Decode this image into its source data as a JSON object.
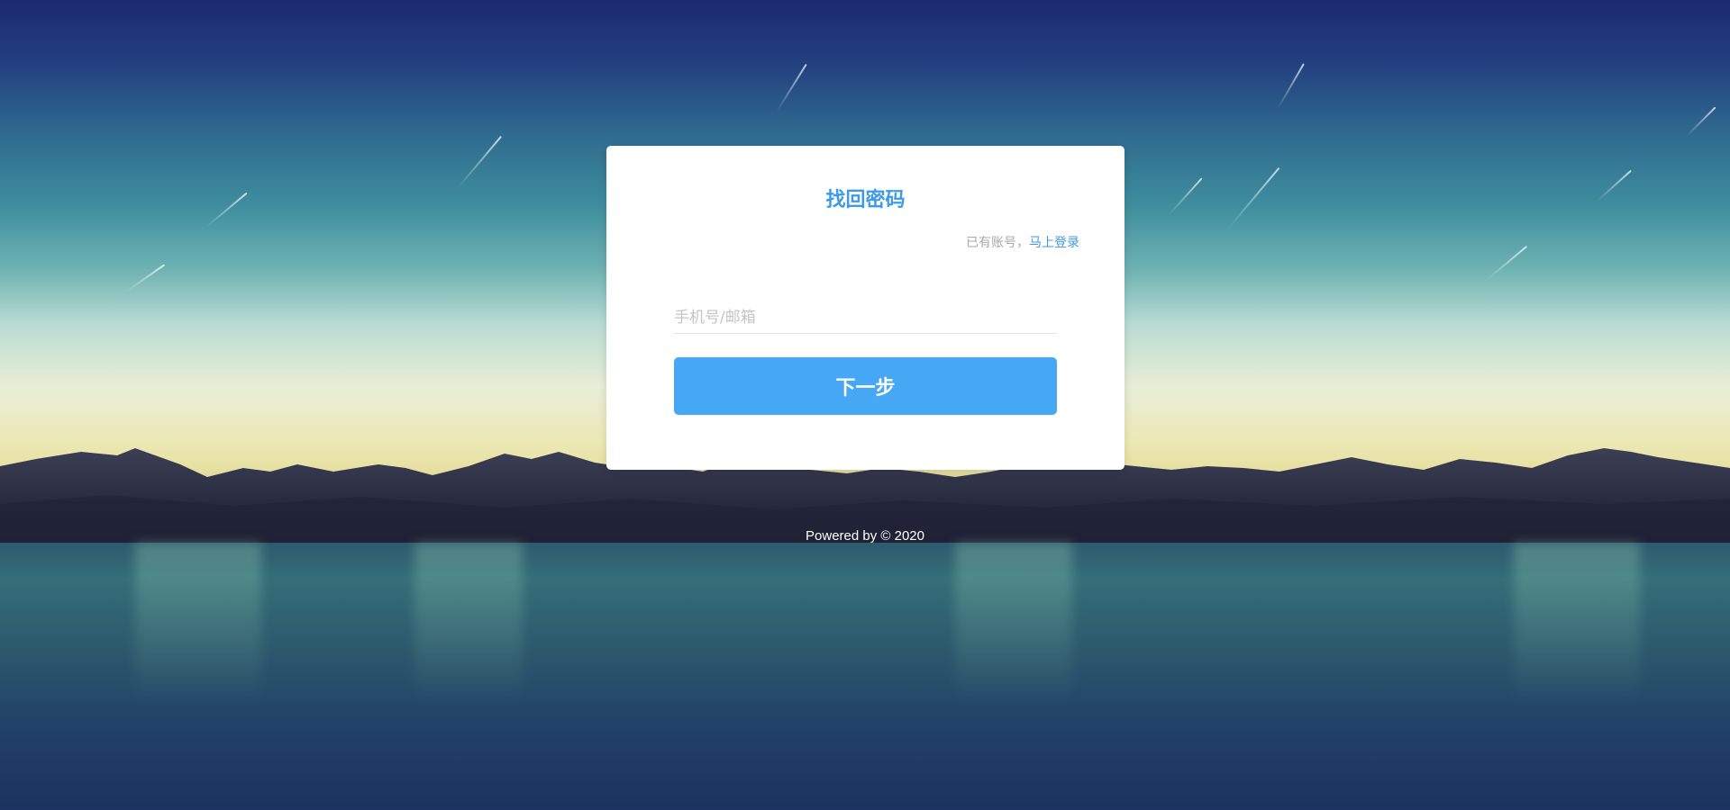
{
  "form": {
    "title": "找回密码",
    "has_account_text": "已有账号，",
    "login_link_label": "马上登录",
    "account_placeholder": "手机号/邮箱",
    "account_value": "",
    "next_button_label": "下一步"
  },
  "footer": {
    "text": "Powered by © 2020"
  },
  "colors": {
    "accent": "#46a8f5",
    "title": "#3d9ae8",
    "panel_background": "#ffffff"
  }
}
